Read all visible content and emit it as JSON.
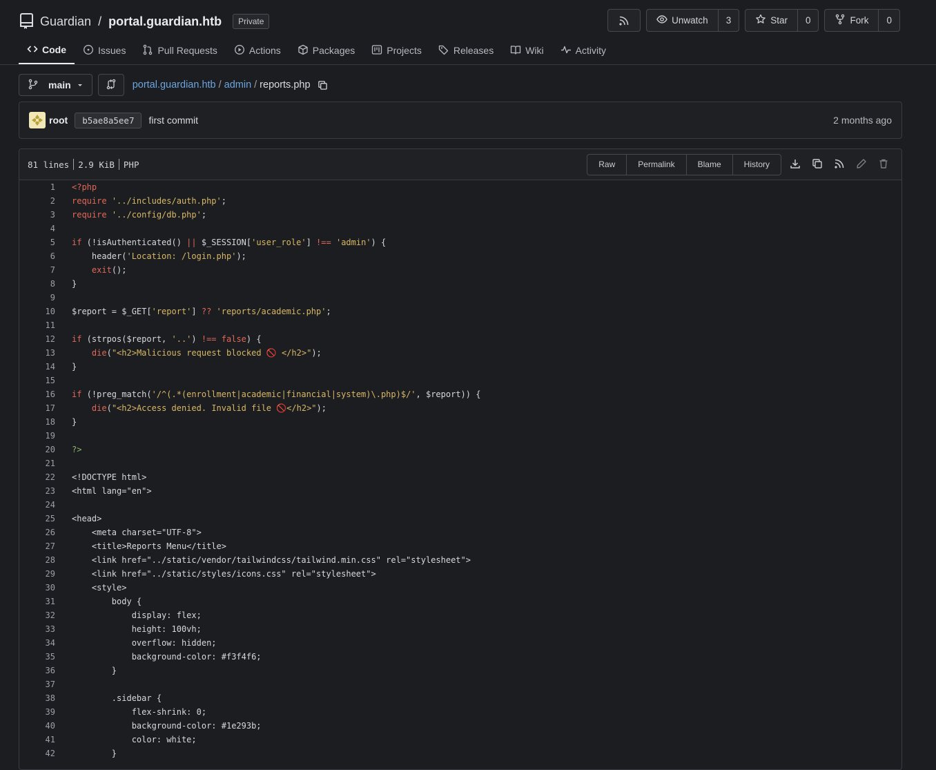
{
  "repo": {
    "owner": "Guardian",
    "slash": "/",
    "name": "portal.guardian.htb",
    "visibility": "Private"
  },
  "actions": {
    "unwatch_label": "Unwatch",
    "unwatch_count": "3",
    "star_label": "Star",
    "star_count": "0",
    "fork_label": "Fork",
    "fork_count": "0"
  },
  "tabs": [
    {
      "label": "Code",
      "icon": "code-icon"
    },
    {
      "label": "Issues",
      "icon": "issue-icon"
    },
    {
      "label": "Pull Requests",
      "icon": "pull-request-icon"
    },
    {
      "label": "Actions",
      "icon": "play-icon"
    },
    {
      "label": "Packages",
      "icon": "package-icon"
    },
    {
      "label": "Projects",
      "icon": "project-icon"
    },
    {
      "label": "Releases",
      "icon": "tag-icon"
    },
    {
      "label": "Wiki",
      "icon": "book-icon"
    },
    {
      "label": "Activity",
      "icon": "pulse-icon"
    }
  ],
  "branch": {
    "name": "main"
  },
  "breadcrumb": {
    "repo": "portal.guardian.htb",
    "sep": "/",
    "dir": "admin",
    "file": "reports.php"
  },
  "commit": {
    "author": "root",
    "sha": "b5ae8a5ee7",
    "message": "first commit",
    "time": "2 months ago"
  },
  "file": {
    "lines": "81 lines",
    "size": "2.9 KiB",
    "lang": "PHP",
    "buttons": [
      "Raw",
      "Permalink",
      "Blame",
      "History"
    ]
  },
  "code": [
    "<?php",
    "require '../includes/auth.php';",
    "require '../config/db.php';",
    "",
    "if (!isAuthenticated() || $_SESSION['user_role'] !== 'admin') {",
    "    header('Location: /login.php');",
    "    exit();",
    "}",
    "",
    "$report = $_GET['report'] ?? 'reports/academic.php';",
    "",
    "if (strpos($report, '..') !== false) {",
    "    die(\"<h2>Malicious request blocked 🚫 </h2>\");",
    "}",
    "",
    "if (!preg_match('/^(.*(enrollment|academic|financial|system)\\.php)$/', $report)) {",
    "    die(\"<h2>Access denied. Invalid file 🚫</h2>\");",
    "}",
    "",
    "?>",
    "",
    "<!DOCTYPE html>",
    "<html lang=\"en\">",
    "",
    "<head>",
    "    <meta charset=\"UTF-8\">",
    "    <title>Reports Menu</title>",
    "    <link href=\"../static/vendor/tailwindcss/tailwind.min.css\" rel=\"stylesheet\">",
    "    <link href=\"../static/styles/icons.css\" rel=\"stylesheet\">",
    "    <style>",
    "        body {",
    "            display: flex;",
    "            height: 100vh;",
    "            overflow: hidden;",
    "            background-color: #f3f4f6;",
    "        }",
    "",
    "        .sidebar {",
    "            flex-shrink: 0;",
    "            background-color: #1e293b;",
    "            color: white;",
    "        }"
  ]
}
